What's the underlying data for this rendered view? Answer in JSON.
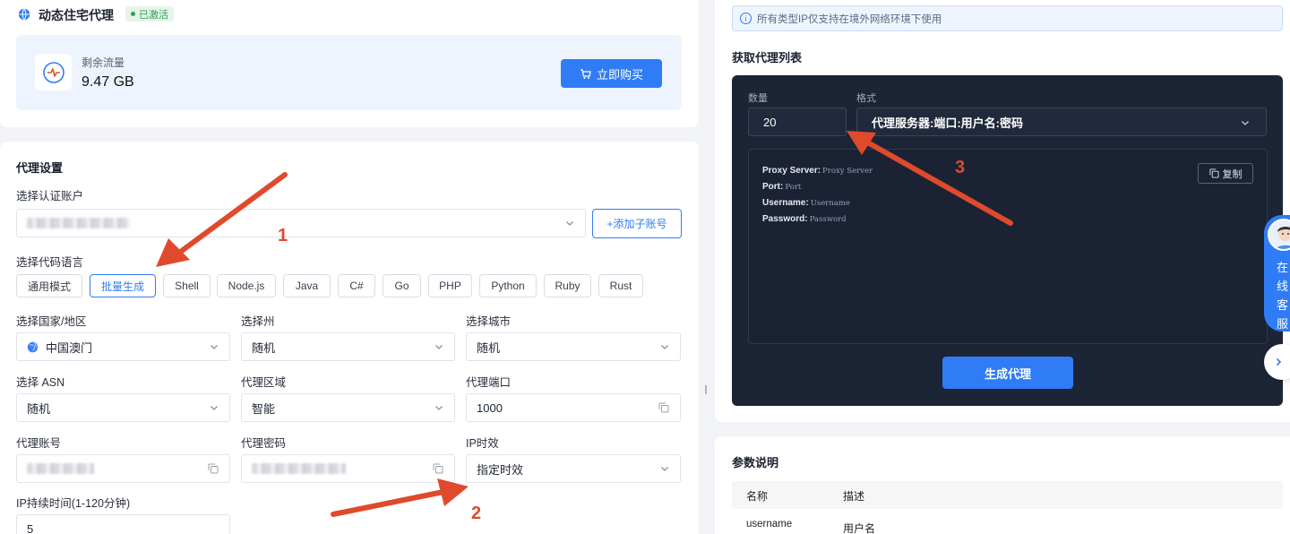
{
  "product": {
    "title": "动态住宅代理",
    "status_badge": "已激活",
    "traffic_label": "剩余流量",
    "traffic_value": "9.47 GB",
    "buy_button": "立即购买"
  },
  "proxy_settings": {
    "section_title": "代理设置",
    "auth_account_label": "选择认证账户",
    "add_sub_account_button": "+添加子账号",
    "code_language_label": "选择代码语言",
    "languages": [
      "通用模式",
      "批量生成",
      "Shell",
      "Node.js",
      "Java",
      "C#",
      "Go",
      "PHP",
      "Python",
      "Ruby",
      "Rust"
    ],
    "active_language": "批量生成",
    "country_label": "选择国家/地区",
    "country_value": "中国澳门",
    "state_label": "选择州",
    "state_value": "随机",
    "city_label": "选择城市",
    "city_value": "随机",
    "asn_label": "选择 ASN",
    "asn_value": "随机",
    "region_label": "代理区域",
    "region_value": "智能",
    "port_label": "代理端口",
    "port_value": "1000",
    "account_label": "代理账号",
    "password_label": "代理密码",
    "ip_validity_label": "IP时效",
    "ip_validity_value": "指定时效",
    "duration_label": "IP持续时间(1-120分钟)",
    "duration_value": "5"
  },
  "right_panel": {
    "notice": "所有类型IP仅支持在境外网络环境下使用",
    "list_title": "获取代理列表",
    "quantity_label": "数量",
    "quantity_value": "20",
    "format_label": "格式",
    "format_value": "代理服务器:端口:用户名:密码",
    "output": [
      {
        "key": "Proxy Server:",
        "value": "Proxy Server"
      },
      {
        "key": "Port:",
        "value": "Port"
      },
      {
        "key": "Username:",
        "value": "Username"
      },
      {
        "key": "Password:",
        "value": "Password"
      }
    ],
    "copy_button": "复制",
    "generate_button": "生成代理",
    "params_title": "参数说明",
    "table_headers": [
      "名称",
      "描述"
    ],
    "table_rows": [
      [
        "username",
        "用户名"
      ]
    ]
  },
  "customer_service": {
    "label": "在线客服"
  },
  "annotations": [
    "1",
    "2",
    "3"
  ],
  "colors": {
    "accent": "#2f7cf6",
    "dark_panel": "#1c2536",
    "annotation": "#e04a2c",
    "active_badge": "#2f9e55"
  }
}
